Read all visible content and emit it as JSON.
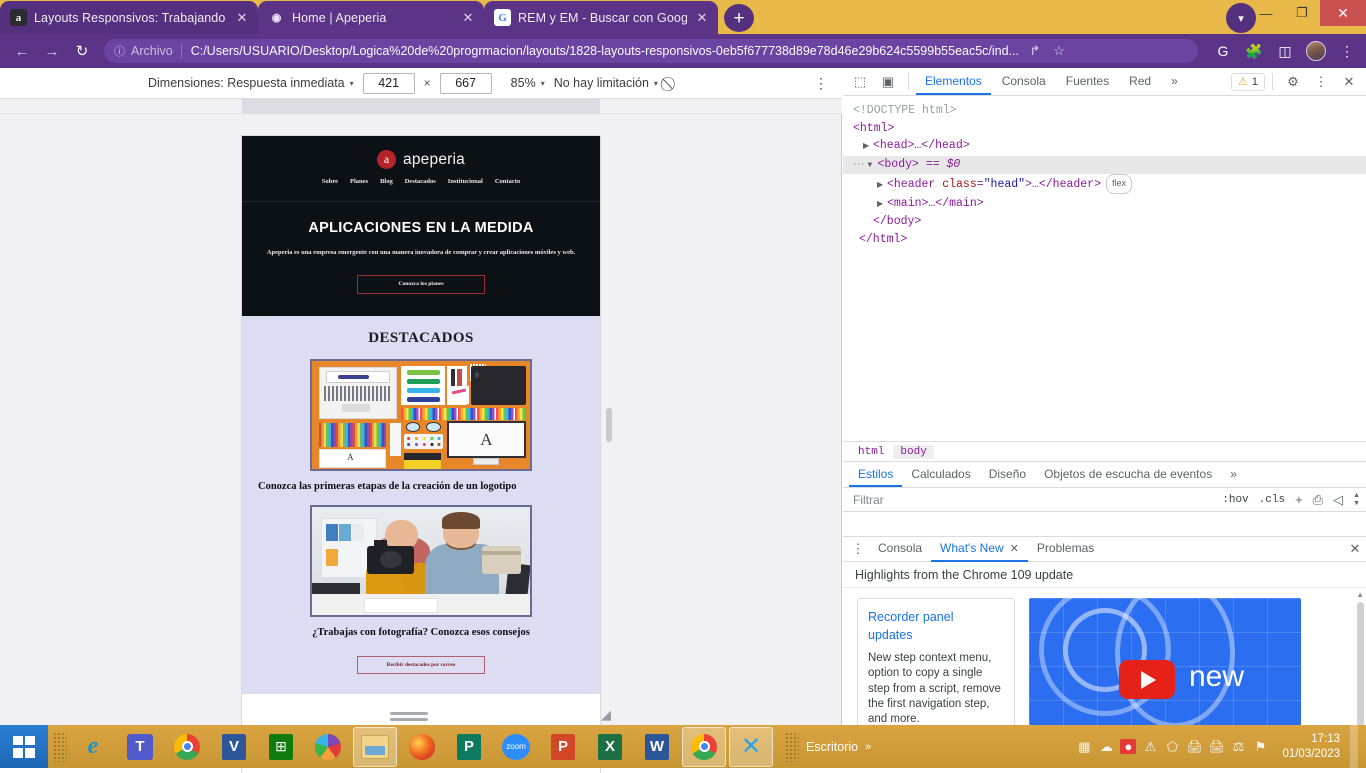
{
  "browser": {
    "tabs": [
      {
        "title": "Layouts Responsivos: Trabajando",
        "favicon": "a",
        "close": "✕"
      },
      {
        "title": "Home | Apeperia",
        "favicon": "◉",
        "close": "✕"
      },
      {
        "title": "REM y EM - Buscar con Google",
        "favicon": "G",
        "close": "✕"
      }
    ],
    "new_tab_label": "+",
    "window_controls": {
      "minimize": "—",
      "maximize": "❐",
      "close": "✕"
    },
    "nav": {
      "back": "←",
      "forward": "→",
      "reload": "↻",
      "scheme_label": "Archivo",
      "info_icon": "ⓘ",
      "url": "C:/Users/USUARIO/Desktop/Logica%20de%20progrmacion/layouts/1828-layouts-responsivos-0eb5f677738d89e78d46e29b624c5599b55eac5c/ind...",
      "share_icon": "↱",
      "bookmark_icon": "☆",
      "translate_icon": "G",
      "extensions_icon": "🧩",
      "sidepanel_icon": "◫",
      "menu_icon": "⋮"
    }
  },
  "device_toolbar": {
    "dimensions_label": "Dimensiones: Respuesta inmediata",
    "width": "421",
    "height": "667",
    "x_separator": "×",
    "zoom": "85%",
    "throttle": "No hay limitación",
    "no_throttle_icon": "⃠",
    "menu_icon": "⋮",
    "caret": "▾"
  },
  "site": {
    "brand": {
      "mark": "a",
      "name": "apeperia"
    },
    "nav": [
      "Sobre",
      "Planes",
      "Blog",
      "Destacados",
      "Institucional",
      "Contacto"
    ],
    "hero": {
      "title": "APLICACIONES EN LA MEDIDA",
      "subtitle": "Apeperia es una empresa emergente con una manera inovadora de comprar y crear aplicaciones móviles y web.",
      "button": "Conozca los planes"
    },
    "section_title": "DESTACADOS",
    "cards": [
      {
        "title": "Conozca las primeras etapas de la creación de un logotipo",
        "image_name": "designer-desk-illustration"
      },
      {
        "title": "¿Trabajas con fotografía? Conozca esos consejos",
        "image_name": "photographers-photo"
      }
    ],
    "subscribe_button": "Recibir destacados por correo"
  },
  "devtools": {
    "toolbar": {
      "inspect_icon": "⬚",
      "device_icon": "▣",
      "tabs": [
        "Elementos",
        "Consola",
        "Fuentes",
        "Red"
      ],
      "more": "»",
      "selected_tab": "Elementos",
      "warning_count": "1",
      "warning_icon": "⚠",
      "settings_icon": "⚙",
      "kebab_icon": "⋮",
      "close_icon": "✕"
    },
    "dom": {
      "doctype": "<!DOCTYPE html>",
      "html_open": "<html>",
      "head_line": "<head>…</head>",
      "body_line": "<body>",
      "body_suffix": "== $0",
      "header_tag": "<header ",
      "header_attr_name": "class",
      "header_attr_value": "\"head\"",
      "header_tail": ">…</header>",
      "header_badge": "flex",
      "main_line": "<main>…</main>",
      "body_close": "</body>",
      "html_close": "</html>",
      "triangle": "▶",
      "triangle_open": "▼",
      "dots": "…"
    },
    "breadcrumb": [
      "html",
      "body"
    ],
    "styles_tabs": [
      "Estilos",
      "Calculados",
      "Diseño",
      "Objetos de escucha de eventos"
    ],
    "styles_more": "»",
    "filter": {
      "placeholder": "Filtrar",
      "hov": ":hov",
      "cls": ".cls",
      "plus": "+",
      "printer_icon": "⎙",
      "panel_icon": "◁"
    },
    "drawer": {
      "kebab": "⋮",
      "tabs": [
        "Consola",
        "What's New",
        "Problemas"
      ],
      "selected_tab": "What's New",
      "close_tab_icon": "✕",
      "close_icon": "✕"
    },
    "whats_new": {
      "heading": "Highlights from the Chrome 109 update",
      "card": {
        "title_line1": "Recorder panel",
        "title_line2": "updates",
        "body": "New step context menu, option to copy a single step from a script, remove the first navigation step, and more."
      },
      "video": {
        "caption": "new",
        "play_icon": "▶"
      }
    }
  },
  "taskbar": {
    "start_label": "Inicio",
    "apps": [
      {
        "name": "internet-explorer",
        "glyph": "e"
      },
      {
        "name": "microsoft-teams",
        "glyph": "T"
      },
      {
        "name": "google-chrome",
        "glyph": ""
      },
      {
        "name": "microsoft-visio",
        "glyph": "V"
      },
      {
        "name": "microsoft-store",
        "glyph": "⊞"
      },
      {
        "name": "picasa",
        "glyph": ""
      },
      {
        "name": "file-explorer",
        "glyph": ""
      },
      {
        "name": "mozilla-firefox",
        "glyph": ""
      },
      {
        "name": "microsoft-publisher",
        "glyph": "P"
      },
      {
        "name": "zoom",
        "glyph": "zoom"
      },
      {
        "name": "microsoft-powerpoint",
        "glyph": "P"
      },
      {
        "name": "microsoft-excel",
        "glyph": "X"
      },
      {
        "name": "microsoft-word",
        "glyph": "W"
      },
      {
        "name": "google-chrome-window",
        "glyph": ""
      },
      {
        "name": "visual-studio-code",
        "glyph": "✕"
      }
    ],
    "desktop_label": "Escritorio",
    "tray_overflow": "»",
    "tray_icons": [
      "signal-bars",
      "network",
      "recording",
      "shield-warning",
      "security",
      "printer",
      "printer-2",
      "usb",
      "flag-error"
    ],
    "clock_time": "17:13",
    "clock_date": "01/03/2023"
  }
}
